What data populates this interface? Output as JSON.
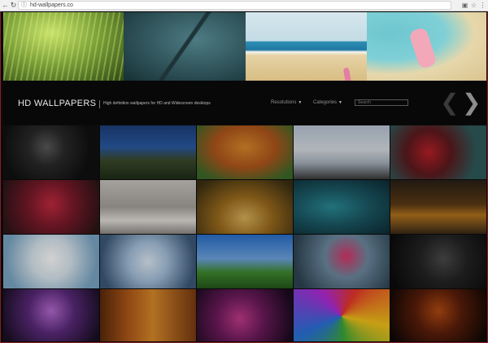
{
  "browser": {
    "back_icon": "arrow-left-icon",
    "reload_icon": "reload-icon",
    "url": "hd-wallpapers.co",
    "site_info_icon": "info-icon",
    "translate_icon": "translate-icon",
    "bookmark_icon": "star-icon",
    "menu_icon": "dots-menu-icon"
  },
  "hero": {
    "images": [
      {
        "subject": "green grass"
      },
      {
        "subject": "dew drops on grass blade"
      },
      {
        "subject": "beach waves and surfboard"
      },
      {
        "subject": "pool float on sand"
      }
    ]
  },
  "header": {
    "logo": "HD WALLPAPERS",
    "tagline": "High definition wallpapers for HD and Widescreen desktops",
    "menu": [
      {
        "label": "Resolutions"
      },
      {
        "label": "Categories"
      }
    ],
    "search_placeholder": "Search",
    "prev_icon": "chevron-left-icon",
    "next_icon": "chevron-right-icon"
  },
  "grid": {
    "tiles": [
      {
        "subject": "cracked glass"
      },
      {
        "subject": "house at dusk"
      },
      {
        "subject": "autumn trees"
      },
      {
        "subject": "couple above clouds"
      },
      {
        "subject": "red flowers on branch"
      },
      {
        "subject": "red tulips"
      },
      {
        "subject": "winter park"
      },
      {
        "subject": "autumn road"
      },
      {
        "subject": "woman in water"
      },
      {
        "subject": "city lights and cup"
      },
      {
        "subject": "frosted tree"
      },
      {
        "subject": "snowy treetops"
      },
      {
        "subject": "green field and sky"
      },
      {
        "subject": "flower in bottle"
      },
      {
        "subject": "dancer"
      },
      {
        "subject": "purple abstract"
      },
      {
        "subject": "autumn forest"
      },
      {
        "subject": "bokeh lights"
      },
      {
        "subject": "colorful swirls"
      },
      {
        "subject": "sparks"
      }
    ]
  }
}
